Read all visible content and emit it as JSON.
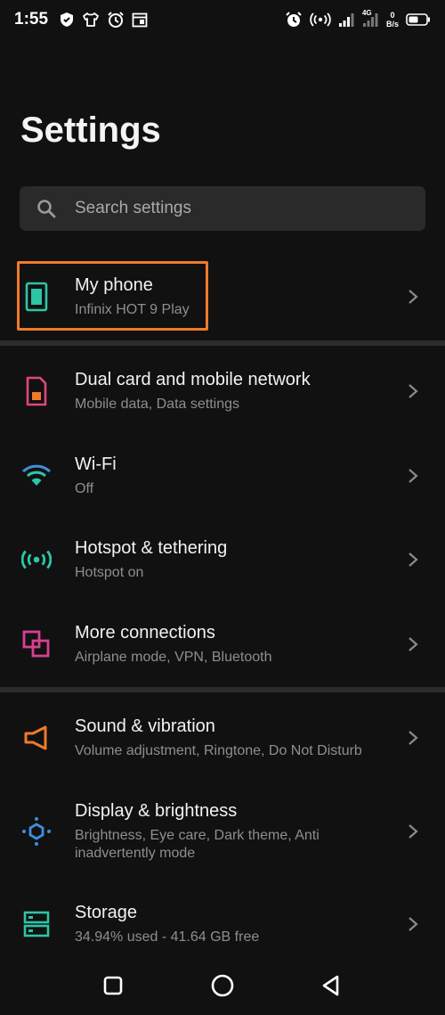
{
  "status_bar": {
    "time": "1:55",
    "net_speed_value": "0",
    "net_speed_unit": "B/s",
    "network_type": "4G"
  },
  "page": {
    "title": "Settings"
  },
  "search": {
    "placeholder": "Search settings"
  },
  "items": [
    {
      "title": "My phone",
      "subtitle": "Infinix HOT 9 Play",
      "icon": "phone-icon",
      "color": "#2ec4a6"
    },
    {
      "title": "Dual card and mobile network",
      "subtitle": "Mobile data, Data settings",
      "icon": "sim-card-icon",
      "color": "#e0477a"
    },
    {
      "title": "Wi-Fi",
      "subtitle": "Off",
      "icon": "wifi-icon",
      "color": "#2ec4a6"
    },
    {
      "title": "Hotspot & tethering",
      "subtitle": "Hotspot on",
      "icon": "hotspot-icon",
      "color": "#2ec4a6"
    },
    {
      "title": "More connections",
      "subtitle": "Airplane mode, VPN, Bluetooth",
      "icon": "connections-icon",
      "color": "#d8408f"
    },
    {
      "title": "Sound & vibration",
      "subtitle": "Volume adjustment, Ringtone, Do Not Disturb",
      "icon": "speaker-icon",
      "color": "#f07a2a"
    },
    {
      "title": "Display & brightness",
      "subtitle": "Brightness, Eye care, Dark theme, Anti inadvertently mode",
      "icon": "display-icon",
      "color": "#3f8fe0"
    },
    {
      "title": "Storage",
      "subtitle": "34.94% used - 41.64 GB free",
      "icon": "storage-icon",
      "color": "#2ec4a6"
    }
  ],
  "highlight_color": "#f07a2a"
}
